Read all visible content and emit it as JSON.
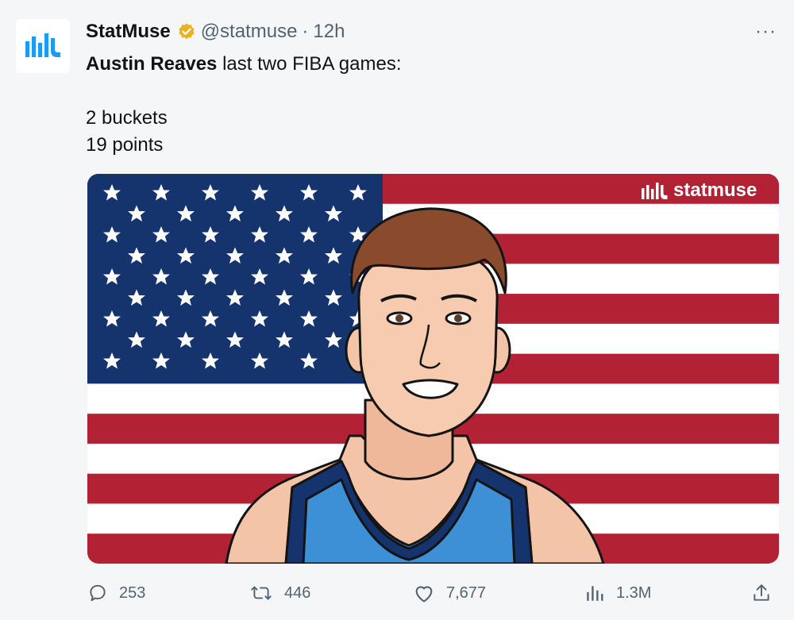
{
  "account": {
    "display_name": "StatMuse",
    "handle": "@statmuse",
    "separator": "·",
    "time": "12h",
    "verified_color": "#e8b322",
    "brand_color": "#1d9bf0"
  },
  "menu": {
    "more_label": "···"
  },
  "tweet": {
    "player_name": "Austin Reaves",
    "headline_rest": " last two FIBA games:",
    "line_buckets": "2 buckets",
    "line_points": "19 points"
  },
  "media": {
    "watermark": "statmuse",
    "flag_colors": {
      "red": "#b22234",
      "blue": "#15336d",
      "white": "#ffffff"
    },
    "jersey_color": "#3d8fd6"
  },
  "actions": {
    "replies": "253",
    "reposts": "446",
    "likes": "7,677",
    "views": "1.3M"
  }
}
